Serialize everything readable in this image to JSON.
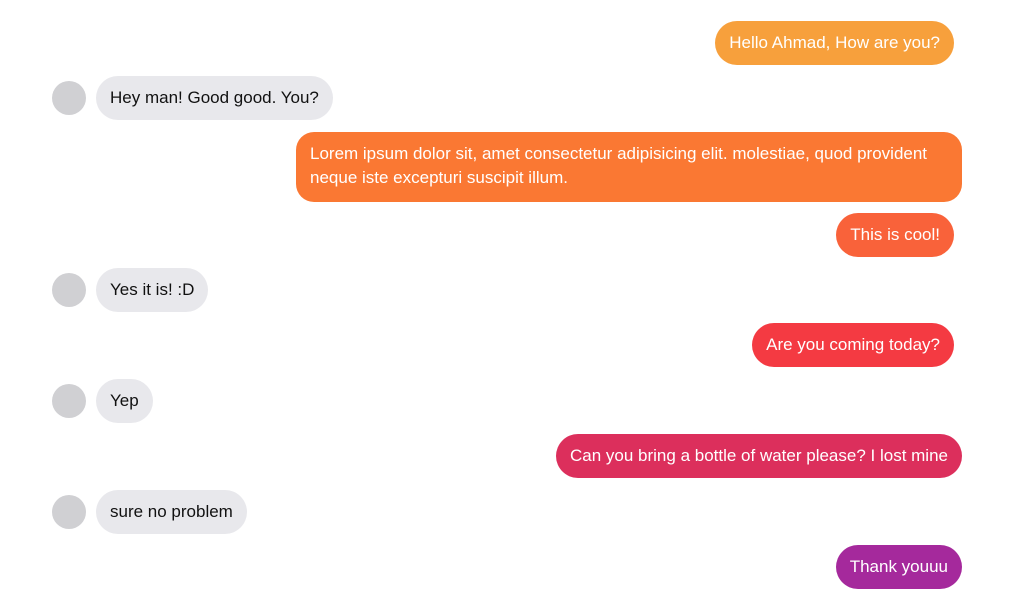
{
  "conversation": {
    "messages": [
      {
        "sender": "me",
        "text": "Hello Ahmad, How are you?",
        "color": "#f7a03c"
      },
      {
        "sender": "them",
        "text": "Hey man! Good good. You?"
      },
      {
        "sender": "me",
        "text": "Lorem ipsum dolor sit, amet consectetur adipisicing elit. molestiae, quod provident neque iste excepturi suscipit illum.",
        "color": "#fa7833"
      },
      {
        "sender": "me",
        "text": "This is cool!",
        "color": "#f9623a"
      },
      {
        "sender": "them",
        "text": "Yes it is! :D"
      },
      {
        "sender": "me",
        "text": "Are you coming today?",
        "color": "#f43a42"
      },
      {
        "sender": "them",
        "text": "Yep"
      },
      {
        "sender": "me",
        "text": "Can you bring a bottle of water please? I lost mine",
        "color": "#dc2f5c"
      },
      {
        "sender": "them",
        "text": "sure no problem"
      },
      {
        "sender": "me",
        "text": "Thank youuu",
        "color": "#a5299c"
      }
    ]
  },
  "colors": {
    "incoming_bubble": "#e8e8ec",
    "avatar": "#d0d0d3",
    "gradient_start": "#f7a03c",
    "gradient_end": "#a5299c"
  },
  "icons": {
    "avatar": "avatar-placeholder-icon"
  }
}
